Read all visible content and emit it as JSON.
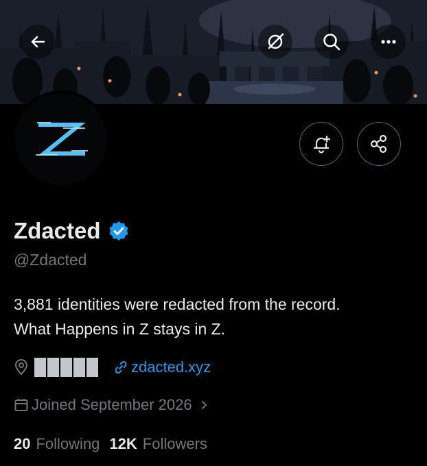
{
  "profile": {
    "name": "Zdacted",
    "handle": "@Zdacted",
    "verified": true,
    "bio_lines": [
      "3,881 identities were redacted from the record.",
      "What Happens in Z stays in Z."
    ],
    "location_redacted_blocks": 5,
    "website": "zdacted.xyz",
    "joined": "Joined September 2026",
    "following_count": "20",
    "following_label": "Following",
    "followers_count": "12K",
    "followers_label": "Followers"
  },
  "icons": {
    "back": "arrow-left-icon",
    "grok": "slashed-circle-icon",
    "search": "search-icon",
    "more": "more-horizontal-icon",
    "notify": "bell-plus-icon",
    "share": "share-icon",
    "location": "location-pin-icon",
    "link": "link-icon",
    "calendar": "calendar-icon",
    "chevron": "chevron-right-icon",
    "verified": "verified-badge-icon"
  },
  "colors": {
    "background": "#000000",
    "text": "#e7e9ea",
    "muted": "#71767b",
    "link": "#1d9bf0",
    "verified": "#1d9bf0",
    "avatar_glow": "#4fc3f7"
  }
}
